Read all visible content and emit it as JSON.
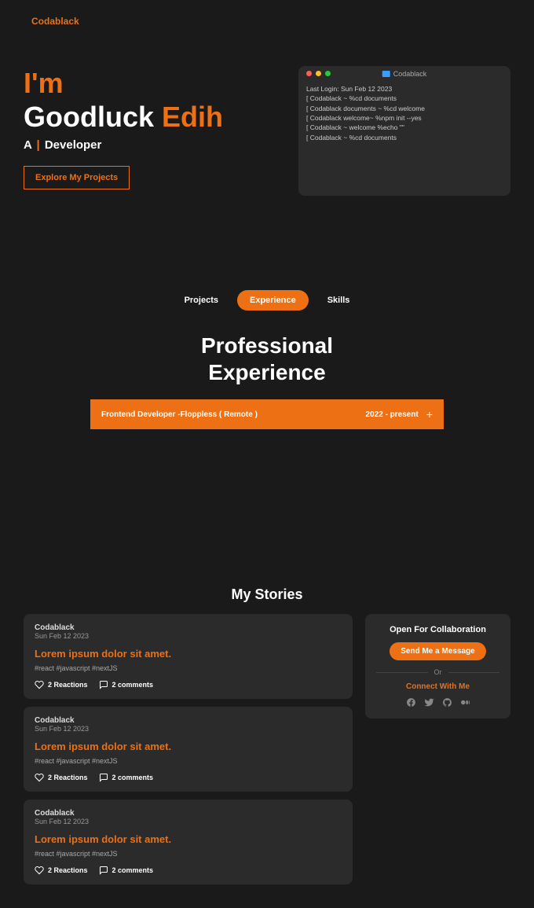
{
  "brand": "Codablack",
  "hero": {
    "line1": "I'm",
    "first_name": "Goodluck",
    "last_name": "Edih",
    "subtitle_a": "A",
    "subtitle_b": "Developer",
    "explore_btn": "Explore My Projects"
  },
  "terminal": {
    "title": "Codablack",
    "lines": [
      "Last Login: Sun Feb 12 2023",
      "[ Codablack ~ %cd documents",
      "[ Codablack documents ~ %cd welcome",
      "[ Codablack welcome~ %npm init --yes",
      "[ Codablack ~ welcome %echo \"\"",
      "[ Codablack ~ %cd documents"
    ]
  },
  "tabs": {
    "items": [
      "Projects",
      "Experience",
      "Skills"
    ],
    "active_index": 1
  },
  "section_title_1": "Professional",
  "section_title_2": "Experience",
  "experience": {
    "title": "Frontend Developer -Floppless ( Remote )",
    "period": "2022 - present"
  },
  "stories": {
    "heading": "My Stories",
    "cards": [
      {
        "author": "Codablack",
        "date": "Sun Feb 12 2023",
        "title": "Lorem ipsum dolor sit amet.",
        "tags": "#react  #javascript  #nextJS",
        "reactions": "2 Reactions",
        "comments": "2 comments"
      },
      {
        "author": "Codablack",
        "date": "Sun Feb 12 2023",
        "title": "Lorem ipsum dolor sit amet.",
        "tags": "#react  #javascript  #nextJS",
        "reactions": "2 Reactions",
        "comments": "2 comments"
      },
      {
        "author": "Codablack",
        "date": "Sun Feb 12 2023",
        "title": "Lorem ipsum dolor sit amet.",
        "tags": "#react  #javascript  #nextJS",
        "reactions": "2 Reactions",
        "comments": "2 comments"
      }
    ]
  },
  "sidebar": {
    "collab_title": "Open For Collaboration",
    "message_btn": "Send Me a Message",
    "or": "Or",
    "connect": "Connect With Me"
  }
}
